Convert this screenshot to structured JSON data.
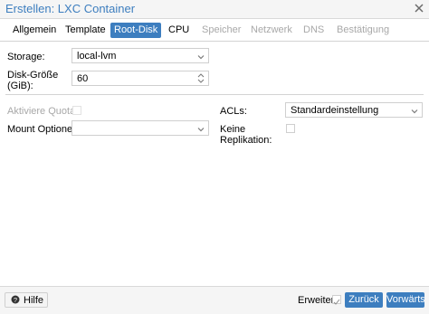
{
  "window": {
    "title": "Erstellen: LXC Container"
  },
  "tabs": [
    {
      "label": "Allgemein",
      "state": "normal"
    },
    {
      "label": "Template",
      "state": "normal"
    },
    {
      "label": "Root-Disk",
      "state": "active"
    },
    {
      "label": "CPU",
      "state": "normal"
    },
    {
      "label": "Speicher",
      "state": "disabled"
    },
    {
      "label": "Netzwerk",
      "state": "disabled"
    },
    {
      "label": "DNS",
      "state": "disabled"
    },
    {
      "label": "Bestätigung",
      "state": "disabled"
    }
  ],
  "form": {
    "storage_label": "Storage:",
    "storage_value": "local-lvm",
    "disk_size_label_line1": "Disk-Größe",
    "disk_size_label_line2": "(GiB):",
    "disk_size_value": "60",
    "quota_label": "Aktiviere Quota:",
    "mount_options_label": "Mount Optionen:",
    "mount_options_value": "",
    "acls_label": "ACLs:",
    "acls_value": "Standardeinstellung",
    "replication_label_line1": "Keine",
    "replication_label_line2": "Replikation:"
  },
  "footer": {
    "help_label": "Hilfe",
    "advanced_label": "Erweitert",
    "back_label": "Zurück",
    "next_label": "Vorwärts"
  },
  "colors": {
    "accent": "#3d7ebf",
    "disabled_text": "#a8a8a8"
  }
}
